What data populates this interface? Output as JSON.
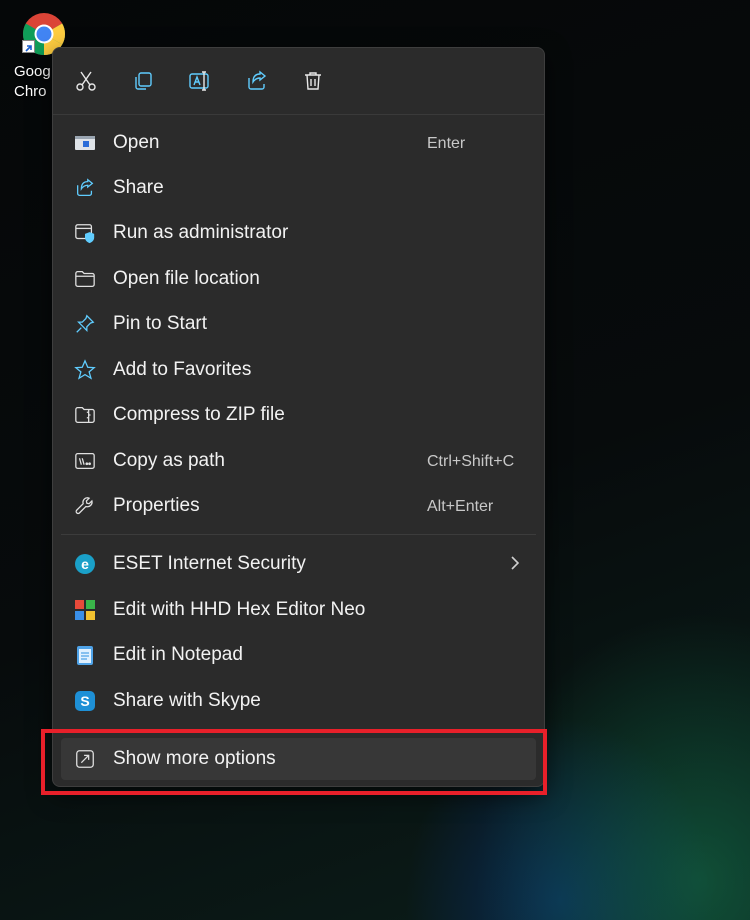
{
  "desktop": {
    "shortcut_label": "Goog\nChro",
    "icon": "google-chrome-icon"
  },
  "toolbar": [
    {
      "name": "cut-icon"
    },
    {
      "name": "copy-icon"
    },
    {
      "name": "rename-icon"
    },
    {
      "name": "share-icon"
    },
    {
      "name": "delete-icon"
    }
  ],
  "menu": {
    "items": [
      {
        "label": "Open",
        "shortcut": "Enter",
        "icon": "open-window-icon"
      },
      {
        "label": "Share",
        "shortcut": "",
        "icon": "share-icon"
      },
      {
        "label": "Run as administrator",
        "shortcut": "",
        "icon": "shield-admin-icon"
      },
      {
        "label": "Open file location",
        "shortcut": "",
        "icon": "folder-icon"
      },
      {
        "label": "Pin to Start",
        "shortcut": "",
        "icon": "pin-icon"
      },
      {
        "label": "Add to Favorites",
        "shortcut": "",
        "icon": "star-icon"
      },
      {
        "label": "Compress to ZIP file",
        "shortcut": "",
        "icon": "zip-folder-icon"
      },
      {
        "label": "Copy as path",
        "shortcut": "Ctrl+Shift+C",
        "icon": "copy-path-icon"
      },
      {
        "label": "Properties",
        "shortcut": "Alt+Enter",
        "icon": "wrench-icon"
      }
    ],
    "apps": [
      {
        "label": "ESET Internet Security",
        "icon": "eset-icon",
        "badge": "e",
        "color": "#20a4c4",
        "has_submenu": true
      },
      {
        "label": "Edit with HHD Hex Editor Neo",
        "icon": "hex-editor-icon",
        "badge": "",
        "color": "#e8a33a",
        "has_submenu": false
      },
      {
        "label": "Edit in Notepad",
        "icon": "notepad-icon",
        "badge": "",
        "color": "#4fa3e8",
        "has_submenu": false
      },
      {
        "label": "Share with Skype",
        "icon": "skype-icon",
        "badge": "S",
        "color": "#1e90d6",
        "has_submenu": false
      }
    ],
    "more": {
      "label": "Show more options",
      "icon": "show-more-options-icon"
    }
  },
  "colors": {
    "menu_bg": "#2b2b2b",
    "accent": "#60cdff",
    "highlight": "#e8202a"
  }
}
